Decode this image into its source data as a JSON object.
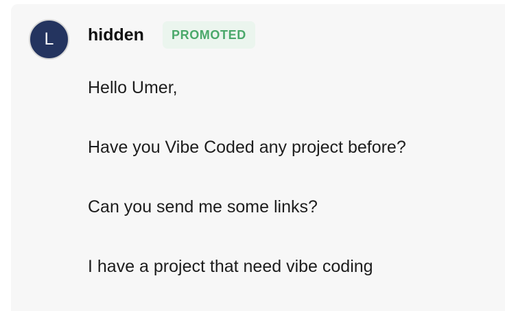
{
  "message": {
    "avatar_initial": "L",
    "sender_name": "hidden",
    "badge": "PROMOTED",
    "lines": [
      "Hello Umer,",
      "Have you Vibe Coded any project before?",
      "Can you send me some links?",
      "I have a project that need vibe coding"
    ]
  },
  "colors": {
    "avatar_bg": "#24345f",
    "badge_bg": "#ebf5ee",
    "badge_text": "#4aa86a",
    "card_bg": "#f7f7f7"
  }
}
